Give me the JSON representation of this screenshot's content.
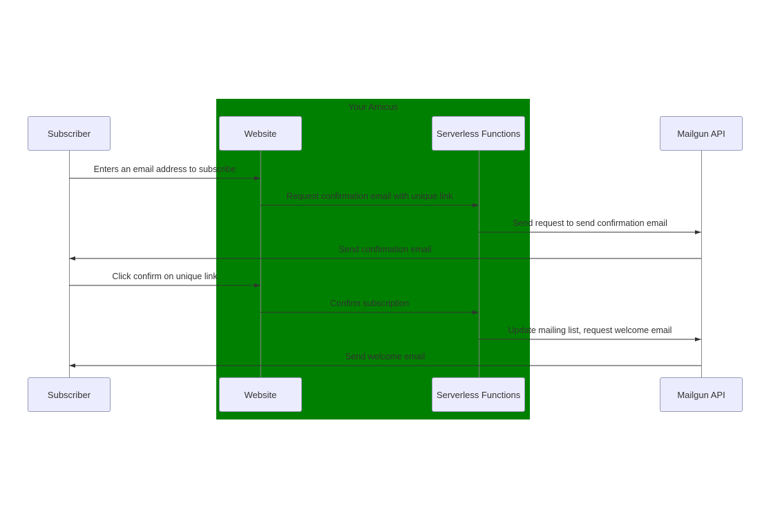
{
  "diagram": {
    "group_title": "Your Amicus",
    "actors": {
      "subscriber": "Subscriber",
      "website": "Website",
      "serverless": "Serverless Functions",
      "mailgun": "Mailgun API"
    },
    "messages": {
      "m1": "Enters an email address to subscribe",
      "m2": "Request confirmation email with unique link",
      "m3": "Send request to send confirmation email",
      "m4": "Send confirmation email",
      "m5": "Click confirm on unique link",
      "m6": "Confirm subscription",
      "m7": "Update mailing list, request welcome email",
      "m8": "Send welcome email"
    }
  },
  "chart_data": {
    "type": "sequence-diagram",
    "group": {
      "name": "Your Amicus",
      "contains": [
        "Website",
        "Serverless Functions"
      ]
    },
    "participants": [
      "Subscriber",
      "Website",
      "Serverless Functions",
      "Mailgun API"
    ],
    "messages": [
      {
        "from": "Subscriber",
        "to": "Website",
        "label": "Enters an email address to subscribe"
      },
      {
        "from": "Website",
        "to": "Serverless Functions",
        "label": "Request confirmation email with unique link"
      },
      {
        "from": "Serverless Functions",
        "to": "Mailgun API",
        "label": "Send request to send confirmation email"
      },
      {
        "from": "Mailgun API",
        "to": "Subscriber",
        "label": "Send confirmation email"
      },
      {
        "from": "Subscriber",
        "to": "Website",
        "label": "Click confirm on unique link"
      },
      {
        "from": "Website",
        "to": "Serverless Functions",
        "label": "Confirm subscription"
      },
      {
        "from": "Serverless Functions",
        "to": "Mailgun API",
        "label": "Update mailing list, request welcome email"
      },
      {
        "from": "Mailgun API",
        "to": "Subscriber",
        "label": "Send welcome email"
      }
    ]
  }
}
